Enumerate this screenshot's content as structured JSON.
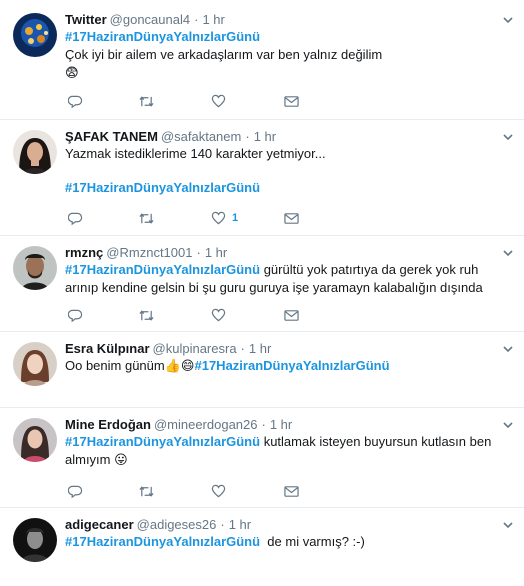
{
  "tweets": [
    {
      "fullname": "Twitter",
      "username": "@goncaunal4",
      "time": "1 hr",
      "line1_hashtag": "#17HaziranDünyaYalnızlarGünü",
      "line2": "Çok iyi bir ailem ve arkadaşlarım var ben yalnız değilim",
      "emoji": "😨",
      "like_count": ""
    },
    {
      "fullname": "ŞAFAK TANEM",
      "username": "@safaktanem",
      "time": "1 hr",
      "line1": "Yazmak istediklerime 140 karakter yetmiyor...",
      "hashtag": "#17HaziranDünyaYalnızlarGünü",
      "like_count": "1"
    },
    {
      "fullname": "rmznç",
      "username": "@Rmznct1001",
      "time": "1 hr",
      "hashtag": "#17HaziranDünyaYalnızlarGünü",
      "text_after": " gürültü yok patırtıya da gerek yok ruh",
      "line2": "arınıp kendine gelsin bi şu guru guruya işe yaramayn kalabalığın dışında",
      "like_count": ""
    },
    {
      "fullname": "Esra Külpınar",
      "username": "@kulpinaresra",
      "time": "1 hr",
      "text_before": "Oo benim günüm",
      "emoji1": "👍",
      "emoji2": "😄",
      "hashtag": "#17HaziranDünyaYalnızlarGünü"
    },
    {
      "fullname": "Mine Erdoğan",
      "username": "@mineerdogan26",
      "time": "1 hr",
      "hashtag": "#17HaziranDünyaYalnızlarGünü",
      "text_after": " kutlamak isteyen buyursun kutlasın ben",
      "line2": "almıyım",
      "emoji": "😛",
      "like_count": ""
    },
    {
      "fullname": "adigecaner",
      "username": "@adigeses26",
      "time": "1 hr",
      "hashtag": "#17HaziranDünyaYalnızlarGünü",
      "text_after": "  de mi varmış? :-)"
    }
  ],
  "colors": {
    "hashtag": "#1b95e0",
    "muted": "#657786",
    "icon": "#657786",
    "divider": "#e6ecf0"
  },
  "icons": {
    "reply": "reply-icon",
    "retweet": "retweet-icon",
    "like": "heart-icon",
    "dm": "envelope-icon",
    "more": "chevron-down-icon"
  }
}
